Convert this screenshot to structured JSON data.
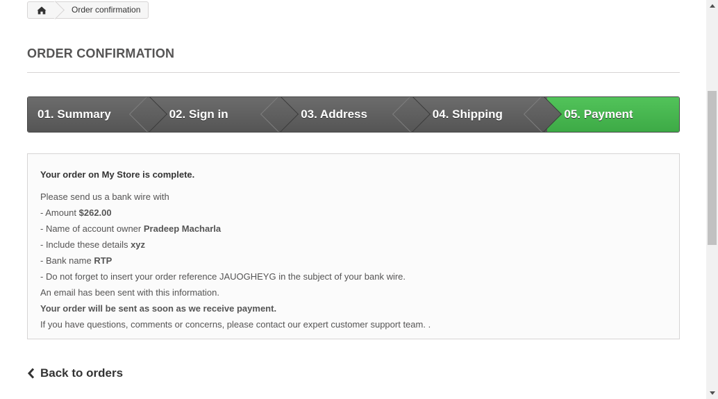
{
  "breadcrumb": {
    "home_icon": "home-icon",
    "current": "Order confirmation"
  },
  "page_title": "ORDER CONFIRMATION",
  "steps": [
    {
      "label": "01. Summary"
    },
    {
      "label": "02. Sign in"
    },
    {
      "label": "03. Address"
    },
    {
      "label": "04. Shipping"
    },
    {
      "label": "05. Payment"
    }
  ],
  "confirmation": {
    "line1_pre": "Your order on ",
    "line1_store": "My Store",
    "line1_post": " is complete.",
    "intro": "Please send us a bank wire with",
    "amount_label": "- Amount ",
    "amount_value": "$262.00",
    "owner_label": "- Name of account owner ",
    "owner_value": "Pradeep Macharla",
    "details_label": "- Include these details ",
    "details_value": "xyz",
    "bank_label": "- Bank name ",
    "bank_value": "RTP",
    "reference_text": "- Do not forget to insert your order reference JAUOGHEYG in the subject of your bank wire.",
    "email_text": "An email has been sent with this information.",
    "sent_text": "Your order will be sent as soon as we receive payment.",
    "questions_pre": "If you have questions, comments or concerns, please contact our ",
    "questions_link": "expert customer support team.",
    "questions_post": " ."
  },
  "back_link": {
    "label": "Back to orders",
    "icon": "chevron-left-icon"
  },
  "colors": {
    "step_active": "#46b04e",
    "step_inactive": "#5f5f5f",
    "text": "#555454"
  }
}
